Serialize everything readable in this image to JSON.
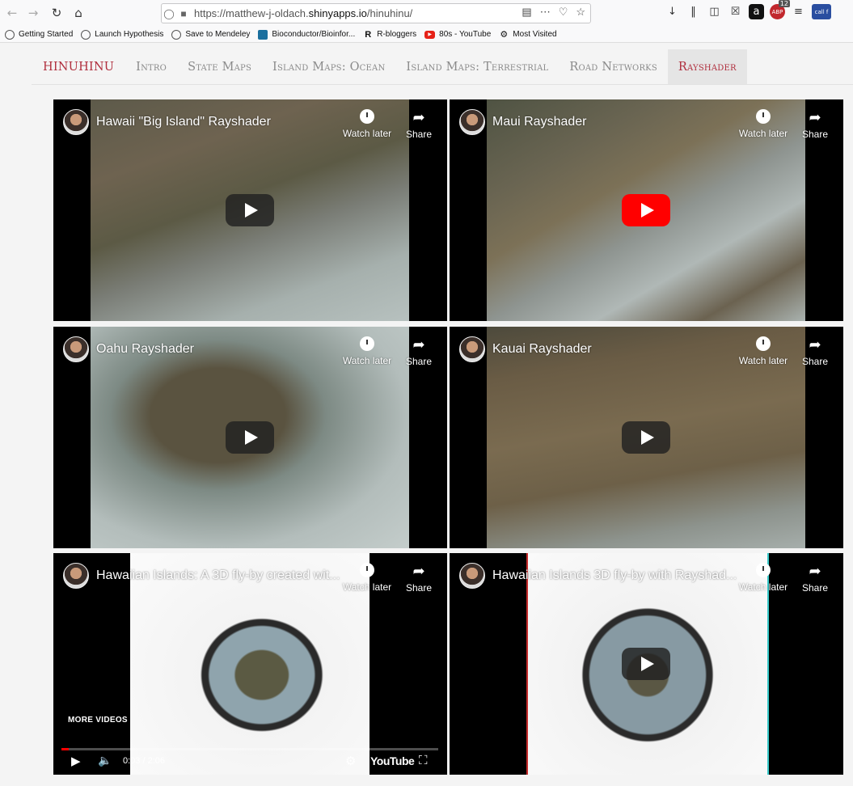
{
  "browser": {
    "url_prefix": "https://matthew-j-oldach.",
    "url_domain": "shinyapps.io",
    "url_path": "/hinuhinu/",
    "badge_count": "12",
    "ext_label": "call f"
  },
  "bookmarks": [
    {
      "label": "Getting Started",
      "icon": "globe-icon"
    },
    {
      "label": "Launch Hypothesis",
      "icon": "globe-icon"
    },
    {
      "label": "Save to Mendeley",
      "icon": "globe-icon"
    },
    {
      "label": "Bioconductor/Bioinfor...",
      "icon": "bioconductor-icon"
    },
    {
      "label": "R-bloggers",
      "icon": "r-icon"
    },
    {
      "label": "80s - YouTube",
      "icon": "youtube-icon"
    },
    {
      "label": "Most Visited",
      "icon": "gear-icon"
    }
  ],
  "nav": {
    "brand": "HINUHINU",
    "tabs": [
      "Intro",
      "State Maps",
      "Island Maps: Ocean",
      "Island Maps: Terrestrial",
      "Road Networks",
      "Rayshader"
    ],
    "active_tab": "Rayshader"
  },
  "video_common": {
    "watch_later": "Watch later",
    "share": "Share"
  },
  "videos": [
    {
      "title": "Hawaii \"Big Island\" Rayshader"
    },
    {
      "title": "Maui Rayshader"
    },
    {
      "title": "Oahu Rayshader"
    },
    {
      "title": "Kauai Rayshader"
    },
    {
      "title": "Hawaiian Islands: A 3D fly-by created wit..."
    },
    {
      "title": "Hawaiian Islands 3D fly-by with Rayshad..."
    }
  ],
  "player": {
    "more_videos": "MORE VIDEOS",
    "time": "0:03 / 2:06",
    "progress": 0.02,
    "logo": "YouTube"
  },
  "colors": {
    "accent": "#b02e3d",
    "play_red": "#ff0000"
  }
}
